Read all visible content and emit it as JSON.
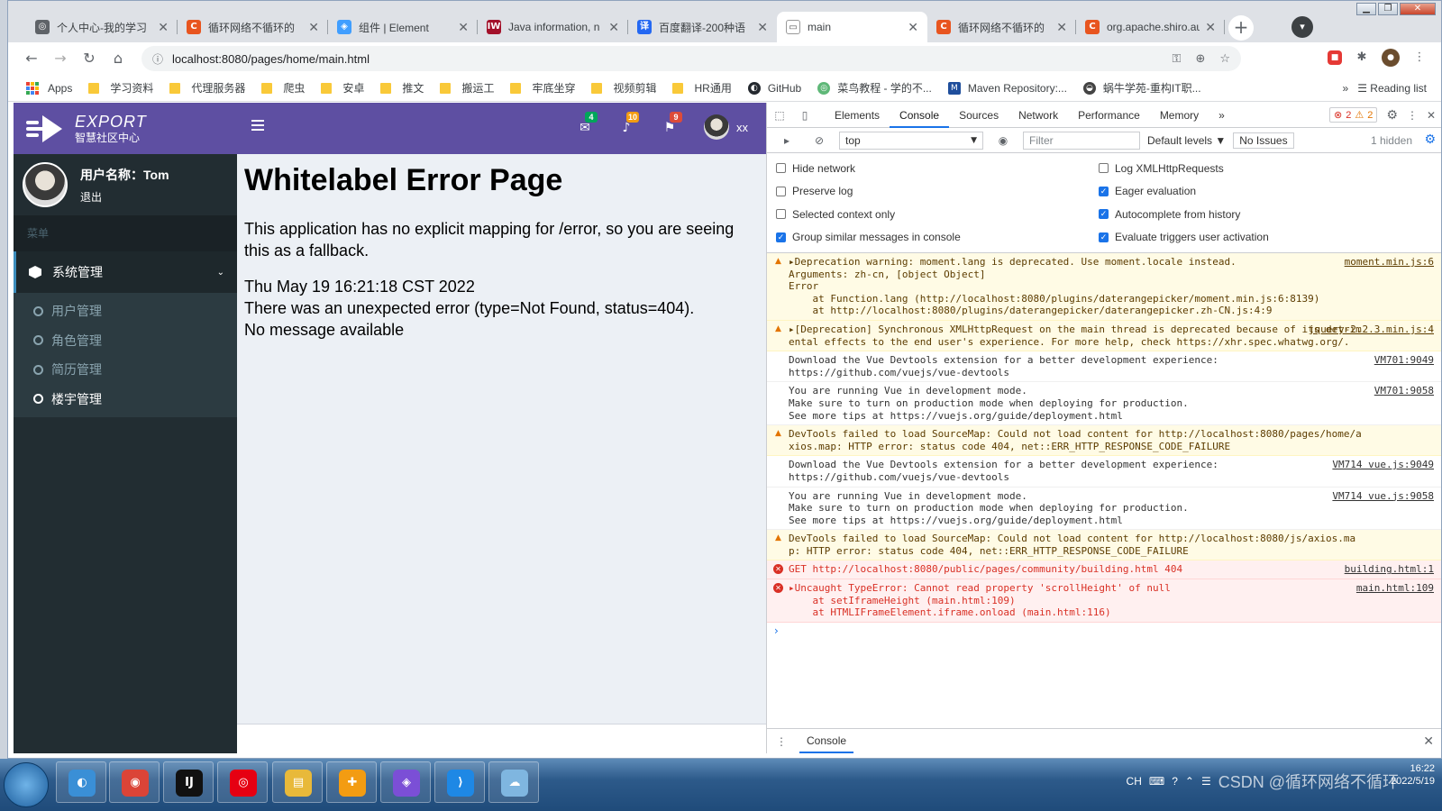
{
  "window": {
    "minimize": "▁",
    "maximize": "❐",
    "close": "✕"
  },
  "tabs": [
    {
      "title": "个人中心-我的学习",
      "fav_color": "#5f6368",
      "fav_glyph": "◎"
    },
    {
      "title": "循环网络不循环的",
      "fav_color": "#e8551f",
      "fav_glyph": "C"
    },
    {
      "title": "组件 | Element",
      "fav_color": "#409eff",
      "fav_glyph": "◈"
    },
    {
      "title": "Java information, n",
      "fav_color": "#a3112a",
      "fav_glyph": "IW"
    },
    {
      "title": "百度翻译-200种语",
      "fav_color": "#2468f2",
      "fav_glyph": "译"
    },
    {
      "title": "main",
      "fav_color": "#ffffff",
      "fav_glyph": "▭",
      "active": true
    },
    {
      "title": "循环网络不循环的",
      "fav_color": "#e8551f",
      "fav_glyph": "C"
    },
    {
      "title": "org.apache.shiro.au",
      "fav_color": "#e8551f",
      "fav_glyph": "C"
    }
  ],
  "tab_close": "✕",
  "new_tab": "+",
  "tab_search": "▾",
  "nav": {
    "back": "←",
    "forward": "→",
    "reload": "↻",
    "home": "⌂"
  },
  "url": "localhost:8080/pages/home/main.html",
  "url_info_icon": "ⓘ",
  "url_icons": [
    "⚿",
    "⊕",
    "☆"
  ],
  "extensions": {
    "red": "■",
    "puzzle": "✱",
    "profile": "●",
    "menu": "⋮"
  },
  "bookmarks": [
    {
      "label": "Apps",
      "type": "apps"
    },
    {
      "label": "学习资料",
      "type": "folder"
    },
    {
      "label": "代理服务器",
      "type": "folder"
    },
    {
      "label": "爬虫",
      "type": "folder"
    },
    {
      "label": "安卓",
      "type": "folder"
    },
    {
      "label": "推文",
      "type": "folder"
    },
    {
      "label": "搬运工",
      "type": "folder"
    },
    {
      "label": "牢底坐穿",
      "type": "folder"
    },
    {
      "label": "视频剪辑",
      "type": "folder"
    },
    {
      "label": "HR通用",
      "type": "folder"
    },
    {
      "label": "GitHub",
      "type": "github"
    },
    {
      "label": "菜鸟教程 - 学的不...",
      "type": "site"
    },
    {
      "label": "Maven Repository:...",
      "type": "mvn"
    },
    {
      "label": "蜗牛学苑-重构IT职...",
      "type": "site2"
    }
  ],
  "bookmarks_more": "»",
  "reading_list": "Reading list",
  "app": {
    "brand_main": "EXPORT",
    "brand_sub": "智慧社区中心",
    "user_label": "用户名称：Tom",
    "logout": "退出",
    "menu_header": "菜单",
    "system_menu": "系统管理",
    "chevron": "⌄",
    "submenu": [
      "用户管理",
      "角色管理",
      "简历管理",
      "楼宇管理"
    ],
    "active_submenu": "楼宇管理",
    "topbar": {
      "mail_icon": "✉",
      "mail_count": "4",
      "mail_color": "#00a65a",
      "bell_icon": "♪",
      "bell_count": "10",
      "bell_color": "#f39c12",
      "flag_icon": "⚑",
      "flag_count": "9",
      "flag_color": "#dd4b39",
      "username": "xx"
    },
    "error": {
      "title": "Whitelabel Error Page",
      "line1": "This application has no explicit mapping for /error, so you are seeing this as a fallback.",
      "timestamp": "Thu May 19 16:21:18 CST 2022",
      "line2": "There was an unexpected error (type=Not Found, status=404).",
      "line3": "No message available"
    }
  },
  "devtools": {
    "tabs": [
      "Elements",
      "Console",
      "Sources",
      "Network",
      "Performance",
      "Memory"
    ],
    "active_tab": "Console",
    "more_tabs": "»",
    "error_count": "2",
    "warning_count": "2",
    "context": "top",
    "filter_placeholder": "Filter",
    "levels": "Default levels ▼",
    "issues": "No Issues",
    "hidden": "1 hidden",
    "settings_left": [
      {
        "label": "Hide network",
        "checked": false
      },
      {
        "label": "Preserve log",
        "checked": false
      },
      {
        "label": "Selected context only",
        "checked": false
      },
      {
        "label": "Group similar messages in console",
        "checked": true
      }
    ],
    "settings_right": [
      {
        "label": "Log XMLHttpRequests",
        "checked": false
      },
      {
        "label": "Eager evaluation",
        "checked": true
      },
      {
        "label": "Autocomplete from history",
        "checked": true
      },
      {
        "label": "Evaluate triggers user activation",
        "checked": true
      }
    ],
    "messages": [
      {
        "level": "warn",
        "src": "moment.min.js:6",
        "lines": [
          "▸Deprecation warning: moment.lang is deprecated. Use moment.locale instead.",
          "Arguments: zh-cn, [object Object]",
          "Error",
          "    at Function.lang (http://localhost:8080/plugins/daterangepicker/moment.min.js:6:8139)",
          "    at http://localhost:8080/plugins/daterangepicker/daterangepicker.zh-CN.js:4:9"
        ]
      },
      {
        "level": "warn",
        "src": "jquery-2.2.3.min.js:4",
        "lines": [
          "▸[Deprecation] Synchronous XMLHttpRequest on the main thread is deprecated because of its detrimental effects to the end user's experience. For more help, check https://xhr.spec.whatwg.org/."
        ]
      },
      {
        "level": "info",
        "src": "VM701:9049",
        "lines": [
          "Download the Vue Devtools extension for a better development experience:",
          "https://github.com/vuejs/vue-devtools"
        ]
      },
      {
        "level": "info",
        "src": "VM701:9058",
        "lines": [
          "You are running Vue in development mode.",
          "Make sure to turn on production mode when deploying for production.",
          "See more tips at https://vuejs.org/guide/deployment.html"
        ]
      },
      {
        "level": "warn",
        "src": "",
        "lines": [
          "DevTools failed to load SourceMap: Could not load content for http://localhost:8080/pages/home/axios.map: HTTP error: status code 404, net::ERR_HTTP_RESPONSE_CODE_FAILURE"
        ]
      },
      {
        "level": "info",
        "src": "VM714 vue.js:9049",
        "lines": [
          "Download the Vue Devtools extension for a better development experience:",
          "https://github.com/vuejs/vue-devtools"
        ]
      },
      {
        "level": "info",
        "src": "VM714 vue.js:9058",
        "lines": [
          "You are running Vue in development mode.",
          "Make sure to turn on production mode when deploying for production.",
          "See more tips at https://vuejs.org/guide/deployment.html"
        ]
      },
      {
        "level": "warn",
        "src": "",
        "lines": [
          "DevTools failed to load SourceMap: Could not load content for http://localhost:8080/js/axios.map: HTTP error: status code 404, net::ERR_HTTP_RESPONSE_CODE_FAILURE"
        ]
      },
      {
        "level": "err",
        "src": "building.html:1",
        "lines": [
          "GET http://localhost:8080/public/pages/community/building.html 404"
        ]
      },
      {
        "level": "err",
        "src": "main.html:109",
        "lines": [
          "▸Uncaught TypeError: Cannot read property 'scrollHeight' of null",
          "    at setIframeHeight (main.html:109)",
          "    at HTMLIFrameElement.iframe.onload (main.html:116)"
        ]
      }
    ],
    "prompt": "›",
    "drawer_tab": "Console",
    "drawer_menu": "⋮",
    "drawer_close": "✕"
  },
  "taskbar": {
    "apps": [
      {
        "glyph": "◐",
        "color": "#3a8fd6"
      },
      {
        "glyph": "◉",
        "color": "#db4437"
      },
      {
        "glyph": "IJ",
        "color": "#111111"
      },
      {
        "glyph": "◎",
        "color": "#e60012"
      },
      {
        "glyph": "▤",
        "color": "#e8b93a"
      },
      {
        "glyph": "✚",
        "color": "#f39c12"
      },
      {
        "glyph": "◈",
        "color": "#7b4fd6"
      },
      {
        "glyph": "⟩",
        "color": "#1e88e5"
      },
      {
        "glyph": "☁",
        "color": "#7fb6e0"
      }
    ],
    "lang": "CH",
    "watermark": "CSDN @循环网络不循环",
    "time": "16:22",
    "date": "2022/5/19"
  }
}
